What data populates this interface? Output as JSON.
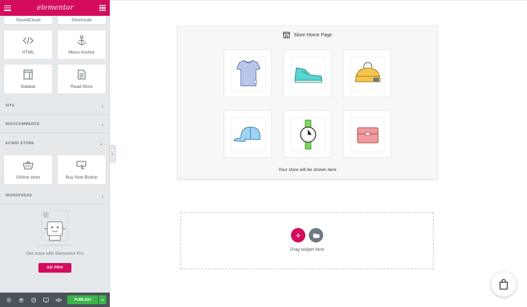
{
  "sidebar": {
    "logo": "elementor",
    "top_row": [
      "SoundCloud",
      "Shortcode"
    ],
    "widgets_row1": [
      "HTML",
      "Menu Anchor"
    ],
    "widgets_row2": [
      "Sidebar",
      "Read More"
    ],
    "sections": [
      "SITE",
      "WOOCOMMERCE",
      "ECWID STORE"
    ],
    "ecwid_widgets": [
      "Online store",
      "Buy Now Button"
    ],
    "section_wordpress": "WORDPRESS",
    "promo_text": "Get more with Elementor Pro",
    "go_pro": "GO PRO"
  },
  "footer": {
    "publish": "PUBLISH",
    "icons": [
      "gear-icon",
      "layers-icon",
      "history-icon",
      "responsive-icon",
      "eye-icon"
    ]
  },
  "store": {
    "title": "Store Home Page",
    "subtitle": "Your store will be shown here",
    "products": [
      "tshirt",
      "sneaker",
      "bag",
      "cap",
      "watch",
      "wallet"
    ]
  },
  "dropzone": {
    "label": "Drag widget here"
  },
  "colors": {
    "brand": "#d30c5c",
    "publish": "#39b54a",
    "sidebar_bg": "#e6e9ec"
  }
}
